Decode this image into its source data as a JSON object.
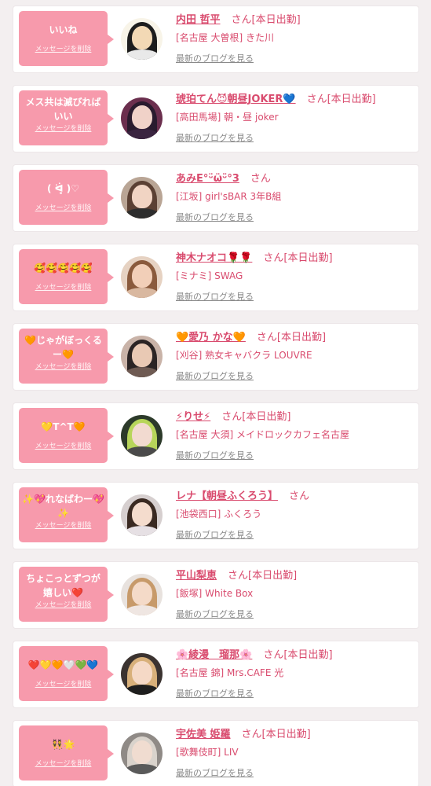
{
  "delete_label": "メッセージを削除",
  "blog_label": "最新のブログを見る",
  "san_label": "さん",
  "colors": {
    "accent": "#d94b6e",
    "bubble": "#f79aac",
    "background": "#f3eff0",
    "link_gray": "#8a8a8a"
  },
  "entries": [
    {
      "message": "いいね",
      "name": "内田 哲平",
      "status": "[本日出勤]",
      "shop": "[名古屋 大曽根] きた川",
      "avatar": {
        "hair": "#1d1d1d",
        "face": "#f3d9b5",
        "body": "#e9e9e9",
        "bg": "#f8f4e8"
      }
    },
    {
      "message": "メス共は滅びればいい",
      "name": "琥珀てん😈朝昼JOKER💙",
      "status": "[本日出勤]",
      "shop": "[高田馬場] 朝・昼 joker",
      "avatar": {
        "hair": "#2a1b2e",
        "face": "#f0d2c8",
        "body": "#3a2440",
        "bg": "#6b2f4e"
      }
    },
    {
      "message": "( ᐛ̥ )♡",
      "name": "あみE°ᵕ̈ω̈ᵕ̈°3",
      "status": "",
      "shop": "[江坂] girl'sBAR 3年B組",
      "avatar": {
        "hair": "#5b4033",
        "face": "#f1d4c3",
        "body": "#2d2d2d",
        "bg": "#b9a595"
      }
    },
    {
      "message": "🥰🥰🥰🥰🥰",
      "name": "神木ナオコ🌹🌹",
      "status": "[本日出勤]",
      "shop": "[ミナミ] SWAG",
      "avatar": {
        "hair": "#8a5a3c",
        "face": "#f2cfb8",
        "body": "#d9b8a0",
        "bg": "#e6d2c2"
      }
    },
    {
      "message": "🧡じゃがぼっくるー🧡",
      "name": "🧡愛乃 かな🧡",
      "status": "[本日出勤]",
      "shop": "[刈谷] 熟女キャバクラ LOUVRE",
      "avatar": {
        "hair": "#2b2424",
        "face": "#e9c9b4",
        "body": "#6e5a52",
        "bg": "#c9b3a8"
      }
    },
    {
      "message": "💛T^T🧡",
      "name": "⚡りせ⚡",
      "status": "[本日出勤]",
      "shop": "[名古屋 大須] メイドロックカフェ名古屋",
      "avatar": {
        "hair": "#b7d55a",
        "face": "#f2dad0",
        "body": "#4a4a4a",
        "bg": "#2c3a2a"
      }
    },
    {
      "message": "✨💖れなばわー💖✨",
      "name": "レナ【朝昼ふくろう】",
      "status": "",
      "shop": "[池袋西口] ふくろう",
      "avatar": {
        "hair": "#3a2a22",
        "face": "#f4dccd",
        "body": "#e6e0e4",
        "bg": "#d6cfcf"
      }
    },
    {
      "message": "ちょこっとずつが嬉しい❤️",
      "name": "平山梨恵",
      "status": "[本日出勤]",
      "shop": "[飯塚] White Box",
      "avatar": {
        "hair": "#c79a6a",
        "face": "#f4dac8",
        "body": "#efe6e2",
        "bg": "#e8e2de"
      }
    },
    {
      "message": "❤️💛🧡🤍💚💙",
      "name": "🌸綾漫　瑠那🌸",
      "status": "[本日出勤]",
      "shop": "[名古屋 錦] Mrs.CAFE 光",
      "avatar": {
        "hair": "#d8b07a",
        "face": "#f5d9c6",
        "body": "#1e1e1e",
        "bg": "#3b3330"
      }
    },
    {
      "message": "👯🌟",
      "name": "宇佐美 姫羅",
      "status": "[本日出勤]",
      "shop": "[歌舞伎町] LIV",
      "avatar": {
        "hair": "#d9d3cc",
        "face": "#f0dcd0",
        "body": "#5a5a5a",
        "bg": "#8f8a86"
      }
    }
  ]
}
